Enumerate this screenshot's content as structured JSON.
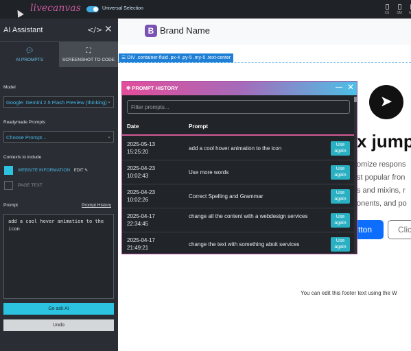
{
  "topbar": {
    "logo": "livecanvas",
    "toggle_label": "Universal Selection",
    "devices": [
      "XS",
      "SM",
      "MD"
    ]
  },
  "sidebar": {
    "title": "AI Assistant",
    "tabs": [
      {
        "label": "AI PROMPTS",
        "icon": "chat-icon"
      },
      {
        "label": "SCREENSHOT TO CODE",
        "icon": "screenshot-icon"
      }
    ],
    "model_label": "Model",
    "model_value": "Google: Gemini 2.5 Flash Preview (thinking)",
    "readymade_label": "Readymade Prompts",
    "readymade_value": "Choose Prompt...",
    "contexts_label": "Contexts to include",
    "ctx_website": "WEBSITE INFORMATION",
    "ctx_edit": "EDIT",
    "ctx_page": "PAGE TEXT",
    "prompt_label": "Prompt",
    "prompt_history_link": "Prompt History",
    "prompt_text": "add a cool hover animation to the icon",
    "go_button": "Go ask AI",
    "undo_button": "Undo",
    "colors": {
      "accent": "#2cc3e0",
      "bg": "#2a2e34"
    }
  },
  "main": {
    "brand_mark": "B",
    "brand_name": "Brand Name",
    "selection_tag": "DIV .container-fluid .px-4 .py-5 .my-5 .text-center",
    "hero_heading": "x jump",
    "hero_lines": [
      "omize respons",
      "st popular fron",
      "s and mixins, r",
      "onents, and po"
    ],
    "hero_button": "tton",
    "hero_button2": "Clic",
    "footer_text": "You can edit this footer text using the W"
  },
  "modal": {
    "title": "PROMPT HISTORY",
    "filter_placeholder": "Filter prompts...",
    "col_date": "Date",
    "col_prompt": "Prompt",
    "use_label": "Use again",
    "rows": [
      {
        "date": "2025-05-13",
        "time": "15:25:20",
        "prompt": "add a cool hover animation to the icon"
      },
      {
        "date": "2025-04-23",
        "time": "10:02:43",
        "prompt": "Use more words"
      },
      {
        "date": "2025-04-23",
        "time": "10:02:26",
        "prompt": "Correct Spelling and Grammar"
      },
      {
        "date": "2025-04-17",
        "time": "22:34:45",
        "prompt": "change all the content with a webdesign services"
      },
      {
        "date": "2025-04-17",
        "time": "21:49:21",
        "prompt": "change the text with something aboit services"
      }
    ]
  }
}
